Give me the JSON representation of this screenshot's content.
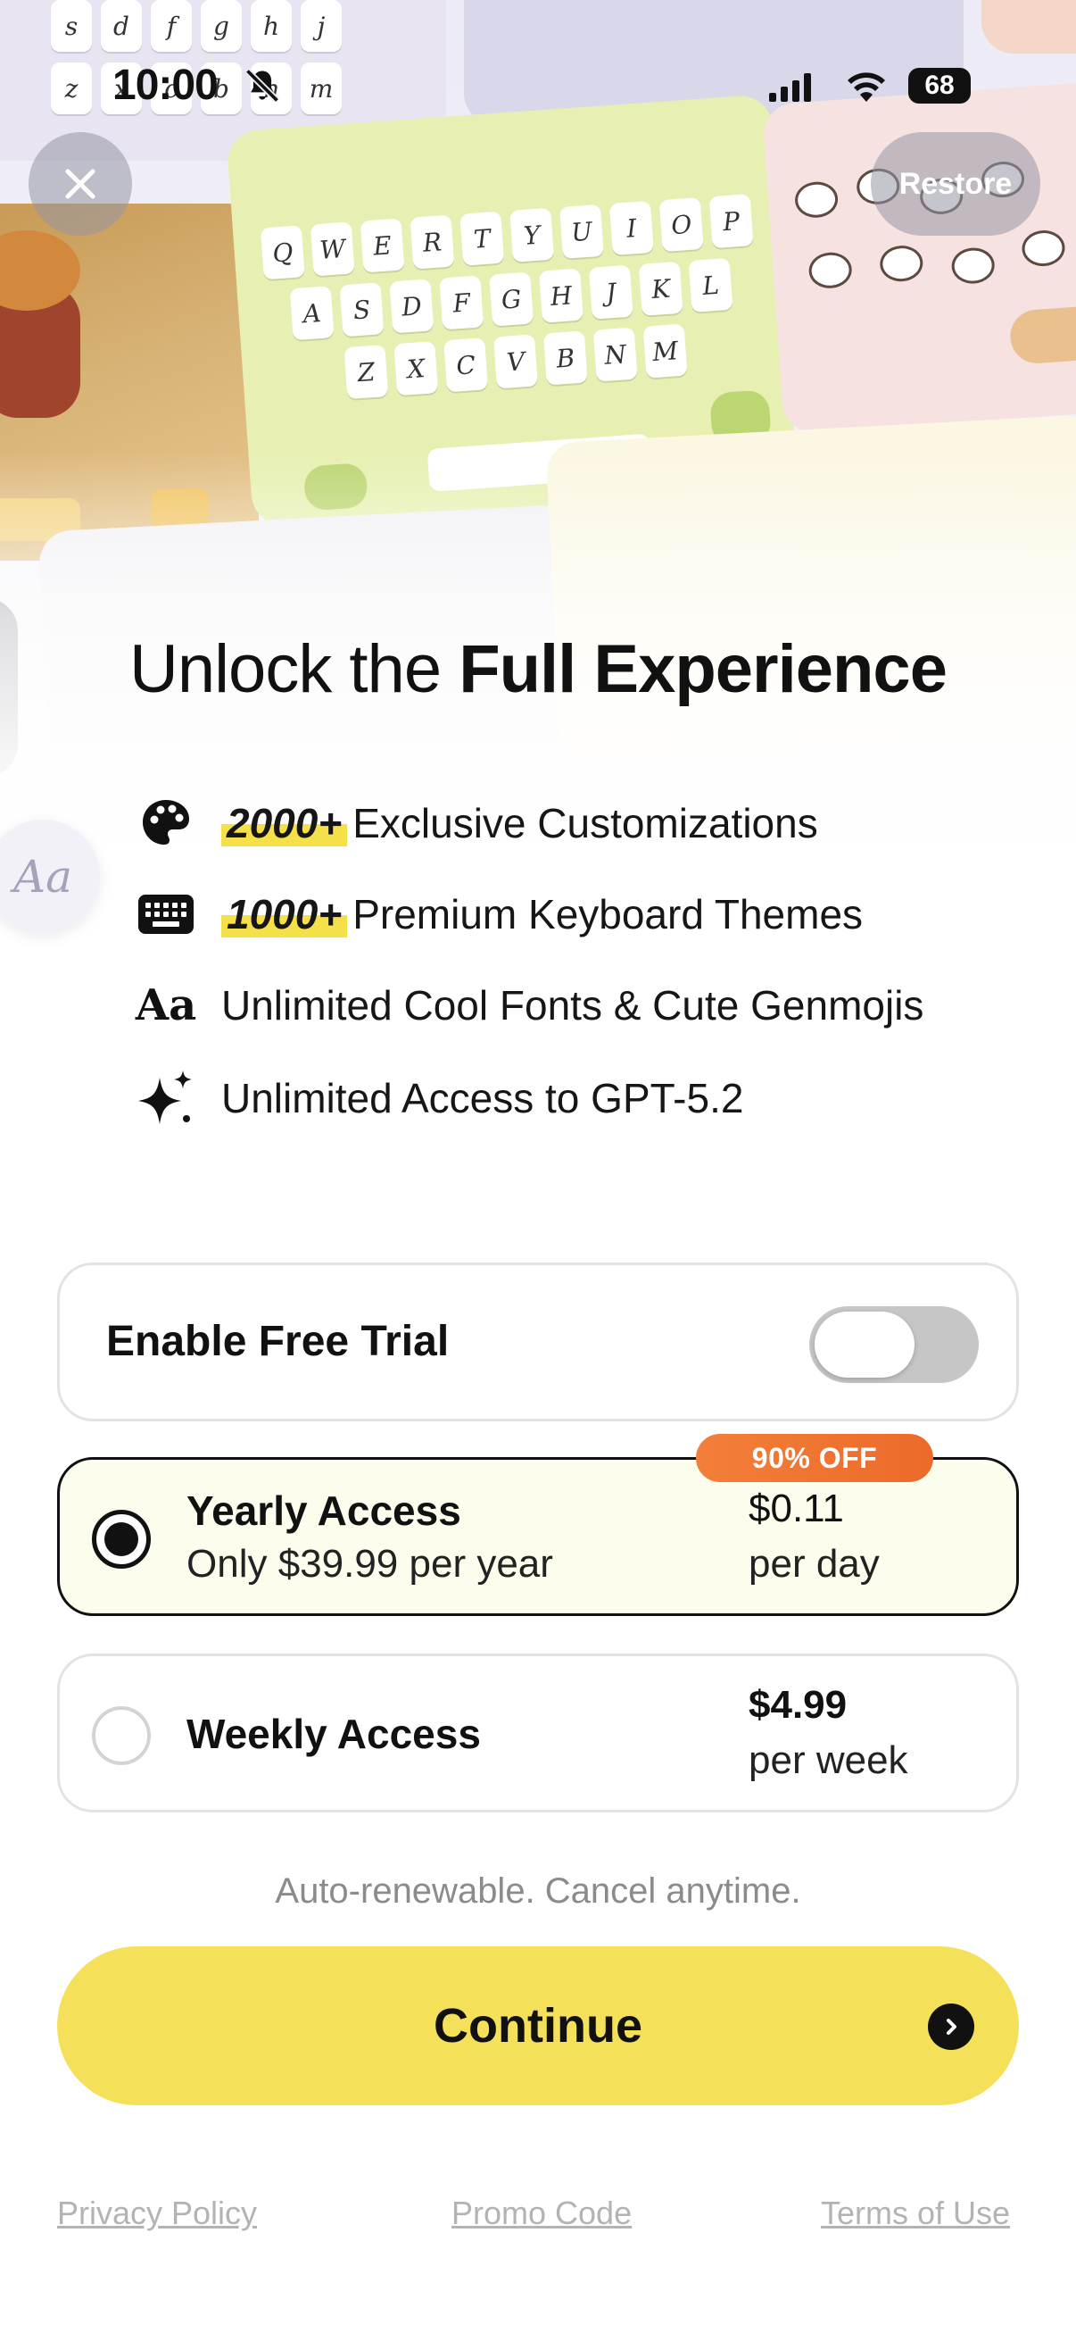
{
  "status_bar": {
    "time": "10:00",
    "battery": "68",
    "icons": [
      "bell-slash-icon",
      "cellular-signal-icon",
      "wifi-icon",
      "battery-icon"
    ]
  },
  "top_bar": {
    "close_icon": "close-icon",
    "restore_label": "Restore"
  },
  "headline": {
    "light": "Unlock the ",
    "bold": "Full Experience"
  },
  "features": [
    {
      "icon": "palette-icon",
      "highlight": "2000+",
      "text": "Exclusive Customizations"
    },
    {
      "icon": "keyboard-icon",
      "highlight": "1000+",
      "text": "Premium Keyboard Themes"
    },
    {
      "icon": "fonts-icon",
      "icon_text": "Aa",
      "highlight": "",
      "text": "Unlimited Cool Fonts & Cute Genmojis"
    },
    {
      "icon": "sparkles-icon",
      "highlight": "",
      "text": "Unlimited Access to GPT-5.2"
    }
  ],
  "free_trial": {
    "label": "Enable Free Trial",
    "enabled": false
  },
  "plans": [
    {
      "id": "yearly",
      "title": "Yearly Access",
      "subtitle": "Only $39.99 per year",
      "price": "$0.11",
      "price_unit": "per day",
      "badge": "90% OFF",
      "selected": true
    },
    {
      "id": "weekly",
      "title": "Weekly Access",
      "subtitle": "",
      "price": "$4.99",
      "price_unit": "per week",
      "selected": false
    }
  ],
  "renew_note": "Auto-renewable. Cancel anytime.",
  "continue_label": "Continue",
  "footer": {
    "privacy": "Privacy Policy",
    "promo": "Promo Code",
    "terms": "Terms of Use"
  },
  "colors": {
    "accent_yellow": "#f5e05a",
    "highlight_yellow": "#f6e04a",
    "badge_orange": "#ec6a2a",
    "selected_card_bg": "#fdfdee"
  }
}
